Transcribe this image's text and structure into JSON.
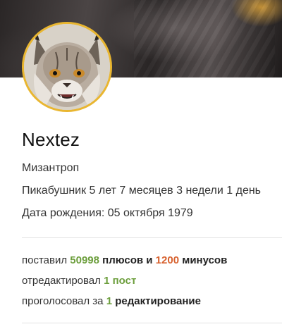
{
  "profile": {
    "name": "Nextez",
    "status": "Мизантроп",
    "member_since": "Пикабушник 5 лет 7 месяцев 3 недели 1 день",
    "birthday": "Дата рождения: 05 октября 1979"
  },
  "stats": {
    "line1_prefix": "поставил",
    "pluses": "50998",
    "line1_mid": "плюсов и",
    "minuses": "1200",
    "line1_suffix": "минусов",
    "line2_prefix": "отредактировал",
    "edited": "1 пост",
    "line3_prefix": "проголосовал за",
    "voted_count": "1",
    "voted_suffix": "редактирование"
  },
  "colors": {
    "accent_green": "#6c9e3c",
    "accent_red": "#d7612e",
    "avatar_border": "#e9b630"
  }
}
